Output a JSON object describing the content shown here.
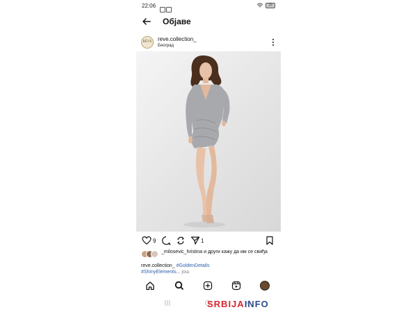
{
  "status_bar": {
    "time": "22:06",
    "battery": "29"
  },
  "header": {
    "title": "Објаве",
    "back_icon": "arrow-left-icon"
  },
  "post": {
    "username": "reve.collection_",
    "location": "Београд",
    "avatar_text": "RÊVE",
    "actions": {
      "like_count": "9",
      "share_count": "1",
      "icons": [
        "heart-icon",
        "comment-icon",
        "repost-icon",
        "share-icon",
        "bookmark-icon"
      ]
    },
    "likes_text": {
      "user": "_milosevic_hristina",
      "rest": " и други кажу да им се свиђа"
    },
    "caption": {
      "username": "reve.collection_",
      "tag1": "#GoldenDetails",
      "tag2": "#ShinyElements...",
      "more": " још"
    }
  },
  "bottom_nav": {
    "icons": [
      "home-icon",
      "search-icon",
      "create-icon",
      "reels-icon",
      "profile-avatar"
    ]
  },
  "watermark": {
    "part1": "SRBIJA",
    "part2": "INFO"
  },
  "colors": {
    "hashtag": "#2b5fad",
    "dress": "#a7a9ad",
    "watermark_red": "#d8262e",
    "watermark_blue": "#2b4a8c"
  }
}
